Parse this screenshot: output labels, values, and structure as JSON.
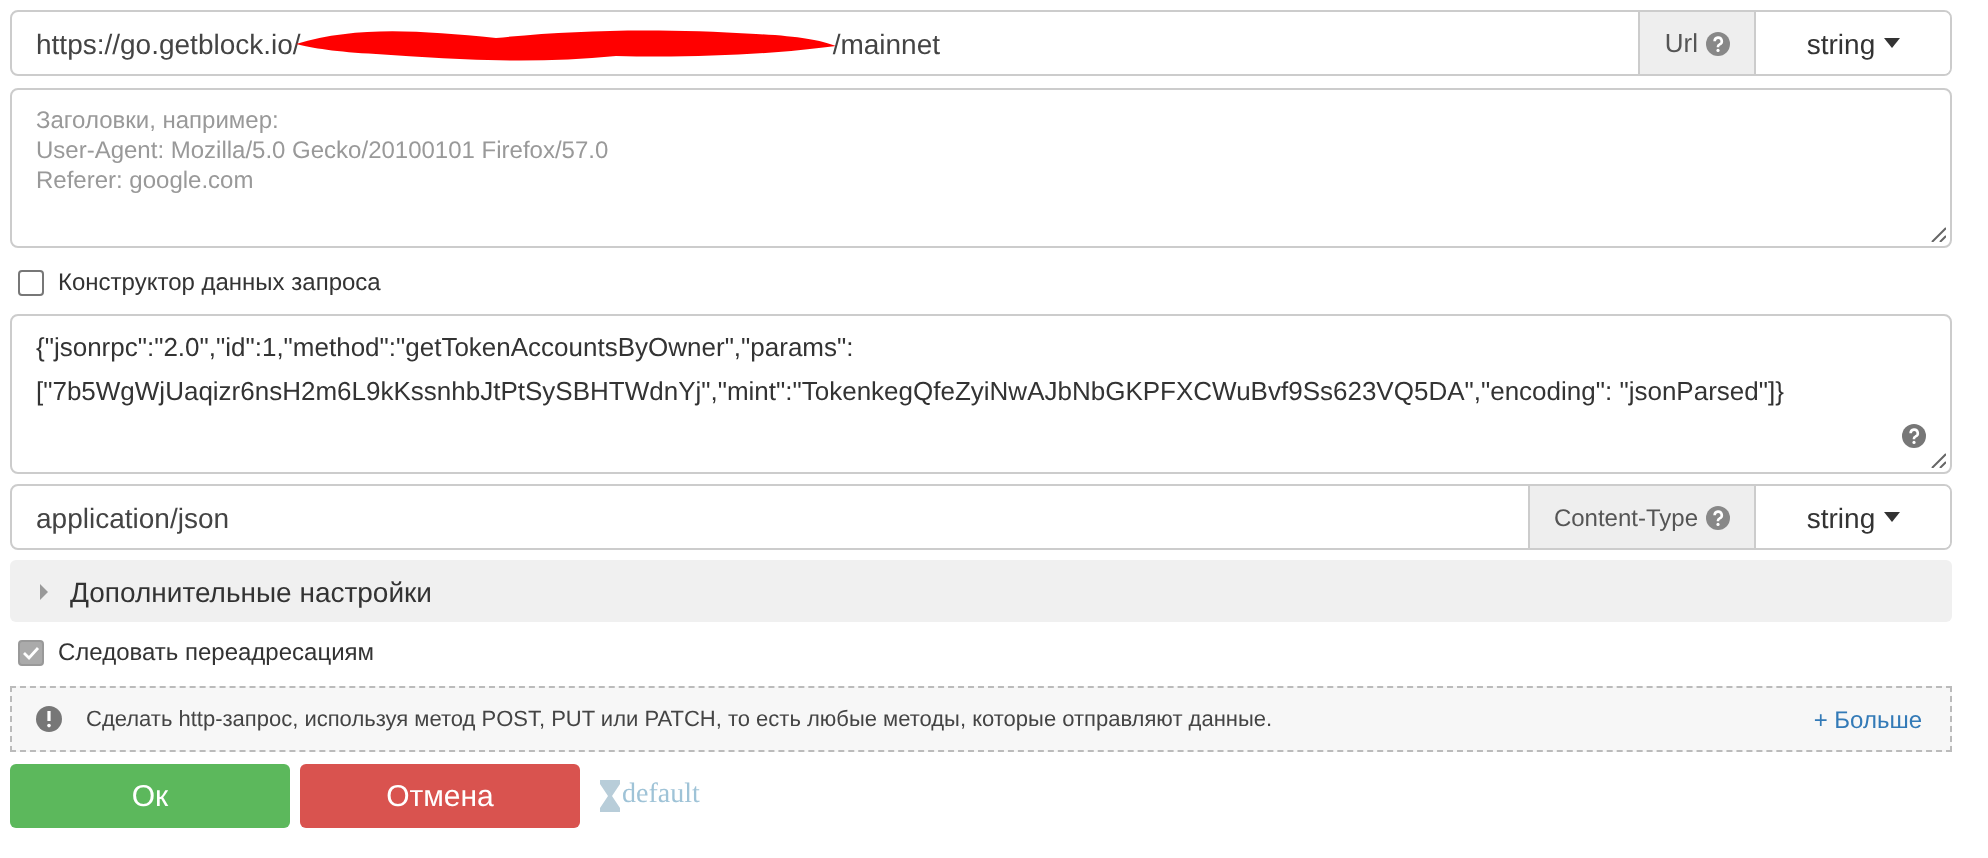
{
  "url_field": {
    "value_parts": [
      "https://go.getblock.io/",
      "/mainnet"
    ],
    "addon_label": "Url",
    "type_select": "string"
  },
  "headers_field": {
    "placeholder_lines": [
      "Заголовки, например:",
      "User-Agent: Mozilla/5.0 Gecko/20100101 Firefox/57.0",
      "Referer: google.com"
    ]
  },
  "request_builder": {
    "label": "Конструктор данных запроса",
    "checked": false
  },
  "body_field": {
    "value_lines": [
      "{\"jsonrpc\":\"2.0\",\"id\":1,\"method\":\"getTokenAccountsByOwner\",\"params\":",
      "[\"7b5WgWjUaqizr6nsH2m6L9kKssnhbJtPtSySBHTWdnYj\",\"mint\":\"TokenkegQfeZyiNwAJbNbGKPFXCWuBvf9Ss623VQ5DA\",\"encoding\": \"jsonParsed\"]}"
    ]
  },
  "content_type_field": {
    "value": "application/json",
    "addon_label": "Content-Type",
    "type_select": "string"
  },
  "advanced_settings": {
    "label": "Дополнительные настройки",
    "expanded": false
  },
  "follow_redirects": {
    "label": "Следовать переадресациям",
    "checked": true
  },
  "hint": {
    "text": "Сделать http-запрос, используя метод POST, PUT или PATCH, то есть любые методы, которые отправляют данные.",
    "more_link": "+ Больше"
  },
  "buttons": [
    {
      "label": "Ок",
      "kind": "ok"
    },
    {
      "label": "Отмена",
      "kind": "cancel"
    }
  ],
  "default_link": "default"
}
